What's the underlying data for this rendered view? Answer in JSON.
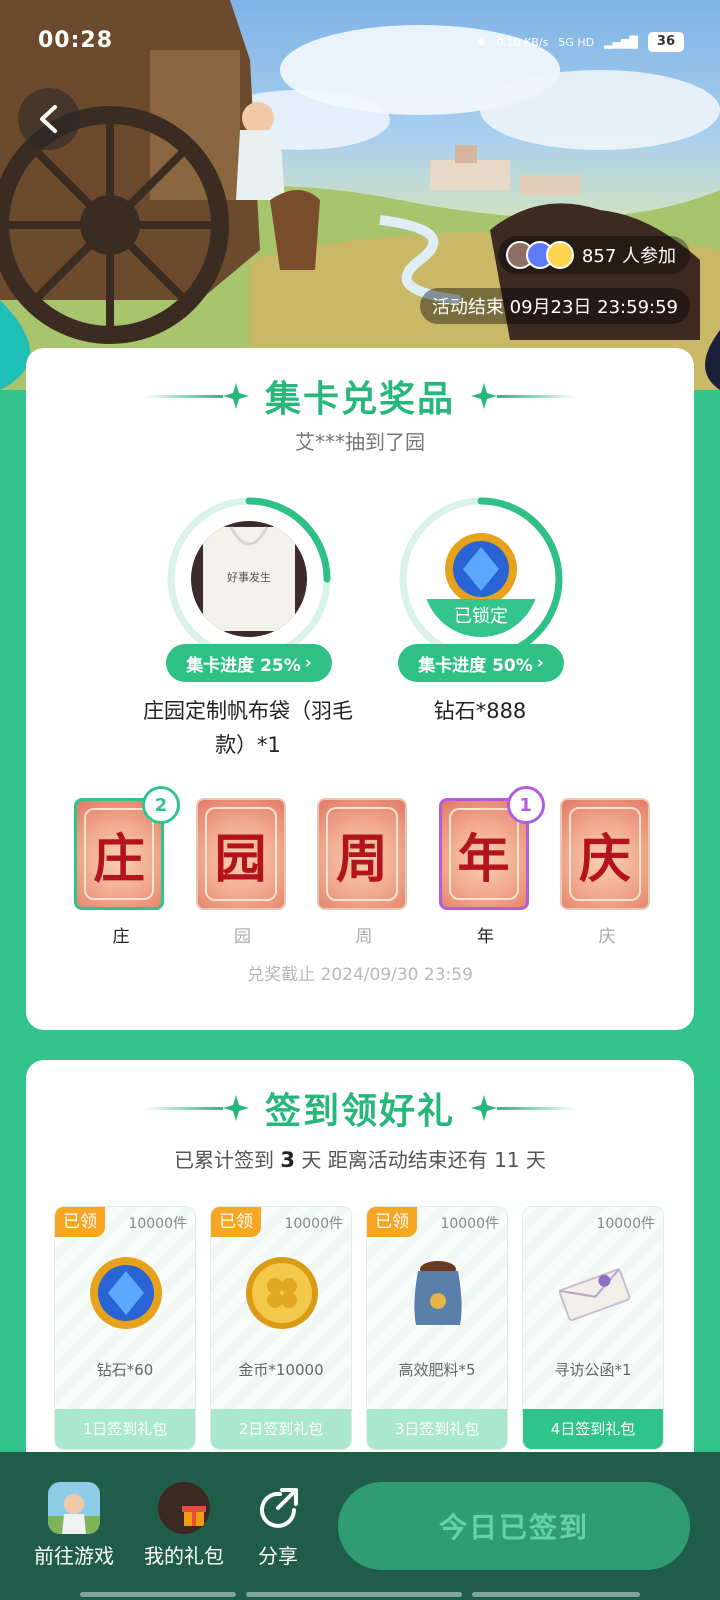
{
  "status": {
    "time": "00:28",
    "net_speed": "0.10 KB/s",
    "network": "5G HD",
    "battery": "36"
  },
  "hero": {
    "participants": "857 人参加",
    "end_time": "活动结束 09月23日 23:59:59"
  },
  "collect": {
    "title": "集卡兑奖品",
    "subtitle": "艾***抽到了园",
    "prizes": [
      {
        "name": "庄园定制帆布袋（羽毛款）*1",
        "progress_label": "集卡进度 25%",
        "progress": 0.25,
        "locked": ""
      },
      {
        "name": "钻石*888",
        "progress_label": "集卡进度 50%",
        "progress": 0.5,
        "locked": "已锁定"
      }
    ],
    "letters": [
      {
        "char": "庄",
        "label": "庄",
        "count": "2"
      },
      {
        "char": "园",
        "label": "园",
        "count": ""
      },
      {
        "char": "周",
        "label": "周",
        "count": ""
      },
      {
        "char": "年",
        "label": "年",
        "count": "1"
      },
      {
        "char": "庆",
        "label": "庆",
        "count": ""
      }
    ],
    "deadline": "兑奖截止 2024/09/30 23:59"
  },
  "signin": {
    "title": "签到领好礼",
    "info_prefix": "已累计签到 ",
    "days": "3",
    "info_middle": " 天  距离活动结束还有 11 天",
    "gifts": [
      {
        "claimed": "已领",
        "qty": "10000件",
        "name": "钻石*60",
        "package": "1日签到礼包",
        "icon": "diamond-icon"
      },
      {
        "claimed": "已领",
        "qty": "10000件",
        "name": "金币*10000",
        "package": "2日签到礼包",
        "icon": "coin-icon"
      },
      {
        "claimed": "已领",
        "qty": "10000件",
        "name": "高效肥料*5",
        "package": "3日签到礼包",
        "icon": "fertilizer-bag-icon"
      },
      {
        "claimed": "",
        "qty": "10000件",
        "name": "寻访公函*1",
        "package": "4日签到礼包",
        "icon": "letter-envelope-icon"
      }
    ]
  },
  "bottom": {
    "go_game": "前往游戏",
    "my_gifts": "我的礼包",
    "share": "分享",
    "signed_button": "今日已签到"
  },
  "colors": {
    "primary": "#33c48d",
    "accent_orange": "#f6a623",
    "purple": "#b45ce0",
    "dark_bar": "#1f5d4a"
  }
}
